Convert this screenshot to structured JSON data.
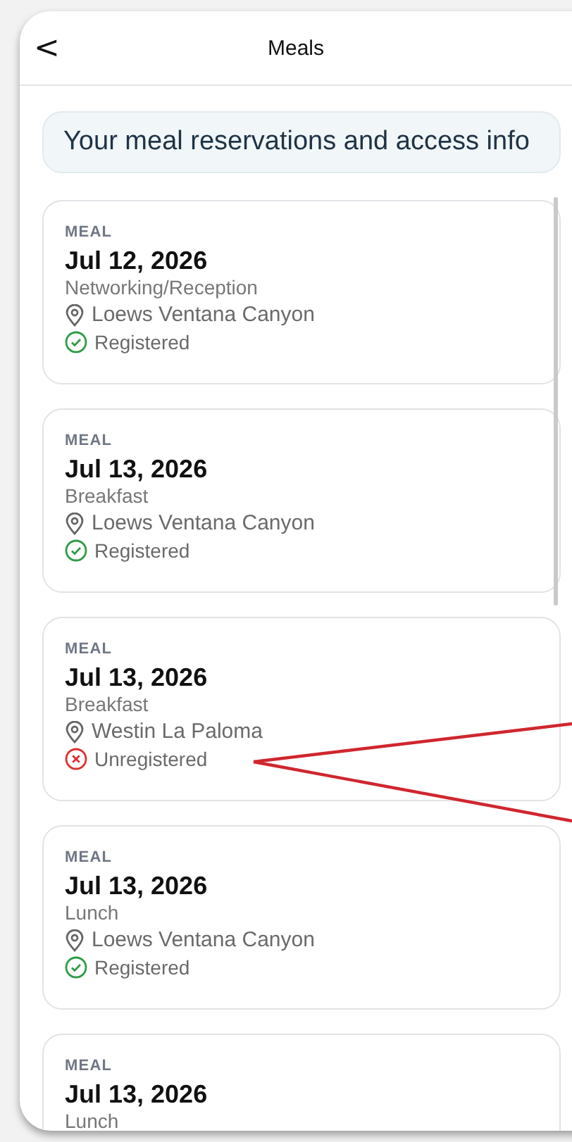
{
  "header": {
    "back": "<",
    "title": "Meals"
  },
  "banner": "Your meal reservations and access info",
  "meals": [
    {
      "label": "MEAL",
      "date": "Jul 12, 2026",
      "type": "Networking/Reception",
      "location": "Loews Ventana Canyon",
      "status": "Registered",
      "registered": true
    },
    {
      "label": "MEAL",
      "date": "Jul 13, 2026",
      "type": "Breakfast",
      "location": "Loews Ventana Canyon",
      "status": "Registered",
      "registered": true
    },
    {
      "label": "MEAL",
      "date": "Jul 13, 2026",
      "type": "Breakfast",
      "location": "Westin La Paloma",
      "status": "Unregistered",
      "registered": false
    },
    {
      "label": "MEAL",
      "date": "Jul 13, 2026",
      "type": "Lunch",
      "location": "Loews Ventana Canyon",
      "status": "Registered",
      "registered": true
    },
    {
      "label": "MEAL",
      "date": "Jul 13, 2026",
      "type": "Lunch"
    }
  ]
}
